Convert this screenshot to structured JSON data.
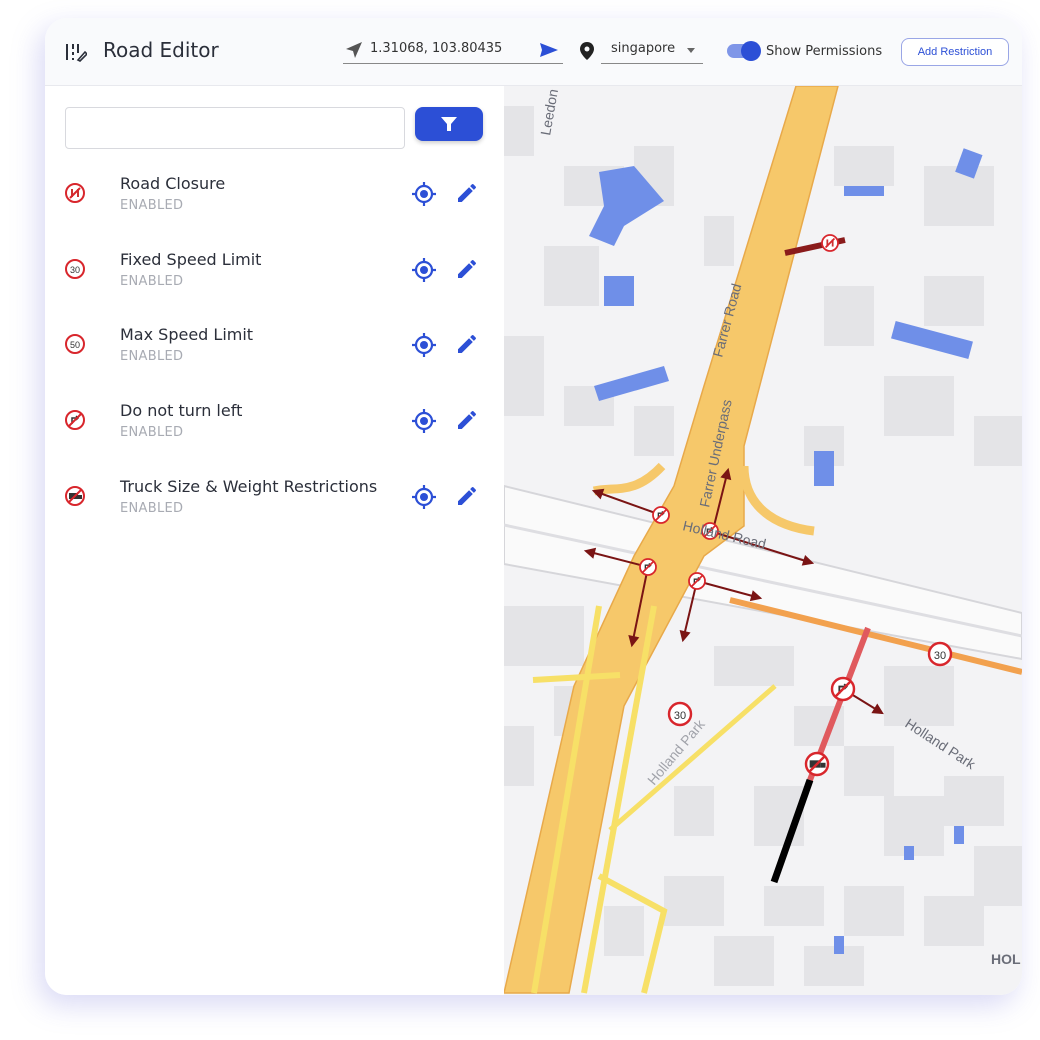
{
  "header": {
    "title": "Road Editor",
    "coordinates": "1.31068, 103.80435",
    "city": "singapore",
    "show_permissions_label": "Show Permissions",
    "show_permissions_on": true,
    "add_restriction_label": "Add Restriction"
  },
  "sidebar": {
    "search_value": "",
    "items": [
      {
        "name": "Road Closure",
        "status": "ENABLED",
        "icon": "road-closure-sign"
      },
      {
        "name": "Fixed Speed Limit",
        "status": "ENABLED",
        "icon": "speed-30-sign",
        "sign_text": "30"
      },
      {
        "name": "Max Speed Limit",
        "status": "ENABLED",
        "icon": "speed-50-sign",
        "sign_text": "50"
      },
      {
        "name": "Do not turn left",
        "status": "ENABLED",
        "icon": "no-left-turn-sign"
      },
      {
        "name": "Truck Size & Weight Restrictions",
        "status": "ENABLED",
        "icon": "no-truck-sign"
      }
    ]
  },
  "map": {
    "labels": {
      "leedon": "Leedon",
      "farrer_road": "Farrer Road",
      "farrer_underpass": "Farrer Underpass",
      "holland_road": "Holland Road",
      "holland_park": "Holland Park",
      "holland_park_2": "Holland Park",
      "hol": "HOL"
    },
    "speed_sign_text": "30"
  },
  "colors": {
    "accent": "#2c4fd6",
    "sign_red": "#d8262c",
    "restriction_arrow": "#7a1414",
    "major_road": "#f6c86a",
    "minor_road": "#f7e067",
    "orange_road": "#f2a14e",
    "red_segment": "#e05a5e"
  }
}
